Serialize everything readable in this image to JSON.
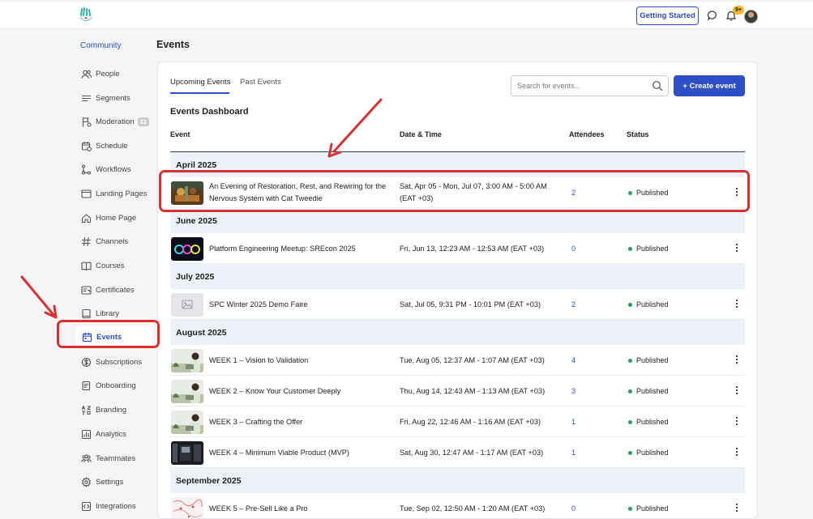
{
  "header": {
    "getting_started": "Getting Started",
    "notification_count": "9+",
    "icons": [
      "app-logo-icon",
      "chat-icon",
      "bell-icon",
      "avatar"
    ]
  },
  "sidebar": {
    "title": "Community",
    "items": [
      {
        "label": "People",
        "icon": "people-icon"
      },
      {
        "label": "Segments",
        "icon": "segments-icon"
      },
      {
        "label": "Moderation",
        "icon": "flag-icon",
        "count": "31"
      },
      {
        "label": "Schedule",
        "icon": "calendar-clock-icon"
      },
      {
        "label": "Workflows",
        "icon": "workflow-icon"
      },
      {
        "label": "Landing Pages",
        "icon": "landing-page-icon"
      },
      {
        "label": "Home Page",
        "icon": "home-icon"
      },
      {
        "label": "Channels",
        "icon": "hash-icon"
      },
      {
        "label": "Courses",
        "icon": "book-open-icon"
      },
      {
        "label": "Certificates",
        "icon": "certificate-icon"
      },
      {
        "label": "Library",
        "icon": "library-icon"
      },
      {
        "label": "Events",
        "icon": "calendar-icon",
        "active": true
      },
      {
        "label": "Subscriptions",
        "icon": "dollar-icon"
      },
      {
        "label": "Onboarding",
        "icon": "onboarding-icon"
      },
      {
        "label": "Branding",
        "icon": "branding-icon"
      },
      {
        "label": "Analytics",
        "icon": "analytics-icon"
      },
      {
        "label": "Teammates",
        "icon": "teammates-icon"
      },
      {
        "label": "Settings",
        "icon": "gear-icon"
      },
      {
        "label": "Integrations",
        "icon": "integrations-icon"
      }
    ]
  },
  "main": {
    "page_title": "Events",
    "tabs": [
      {
        "label": "Upcoming Events",
        "active": true
      },
      {
        "label": "Past Events",
        "active": false
      }
    ],
    "search_placeholder": "Search for events...",
    "create_button": "+ Create event",
    "dashboard_title": "Events Dashboard",
    "columns": [
      "Event",
      "Date & Time",
      "Attendees",
      "Status"
    ],
    "groups": [
      {
        "month": "April 2025",
        "events": [
          {
            "name": "An Evening of Restoration, Rest, and Rewiring for the Nervous System with Cat Tweedie",
            "date": "Sat, Apr 05 - Mon, Jul 07, 3:00 AM - 5:00 AM (EAT +03)",
            "attendees": "2",
            "status": "Published",
            "thumb": "restoration"
          }
        ]
      },
      {
        "month": "June 2025",
        "events": [
          {
            "name": "Platform Engineering Meetup: SREcon 2025",
            "date": "Fri, Jun 13, 12:23 AM - 12:53 AM (EAT +03)",
            "attendees": "0",
            "status": "Published",
            "thumb": "srecon"
          }
        ]
      },
      {
        "month": "July 2025",
        "events": [
          {
            "name": "SPC Winter 2025 Demo Faire",
            "date": "Sat, Jul 05, 9:31 PM - 10:01 PM (EAT +03)",
            "attendees": "2",
            "status": "Published",
            "thumb": "placeholder"
          }
        ]
      },
      {
        "month": "August 2025",
        "events": [
          {
            "name": "WEEK 1 – Vision to Validation",
            "date": "Tue, Aug 05, 12:37 AM - 1:07 AM (EAT +03)",
            "attendees": "4",
            "status": "Published",
            "thumb": "person"
          },
          {
            "name": "WEEK 2 – Know Your Customer Deeply",
            "date": "Thu, Aug 14, 12:43 AM - 1:13 AM (EAT +03)",
            "attendees": "3",
            "status": "Published",
            "thumb": "person"
          },
          {
            "name": "WEEK 3 – Crafting the Offer",
            "date": "Fri, Aug 22, 12:46 AM - 1:16 AM (EAT +03)",
            "attendees": "1",
            "status": "Published",
            "thumb": "person"
          },
          {
            "name": "WEEK 4 – Minimum Viable Product (MVP)",
            "date": "Sat, Aug 30, 12:47 AM - 1:17 AM (EAT +03)",
            "attendees": "1",
            "status": "Published",
            "thumb": "dark"
          }
        ]
      },
      {
        "month": "September 2025",
        "events": [
          {
            "name": "WEEK 5 – Pre-Sell Like a Pro",
            "date": "Tue, Sep 02, 12:50 AM - 1:20 AM (EAT +03)",
            "attendees": "0",
            "status": "Published",
            "thumb": "map"
          }
        ]
      }
    ]
  },
  "colors": {
    "accent": "#2d4ec4",
    "annotation": "#d93131",
    "published": "#22a45d",
    "group_bg": "#edf1f8"
  }
}
